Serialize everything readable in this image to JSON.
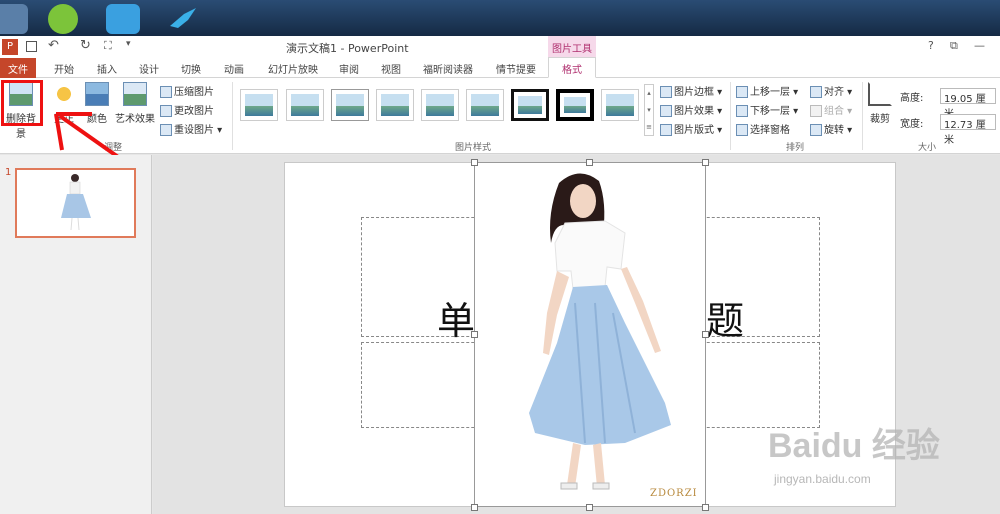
{
  "window": {
    "title": "演示文稿1 - PowerPoint",
    "contextual_group": "图片工具",
    "help": "?",
    "restore": "⧉",
    "minimize": "—"
  },
  "tabs": {
    "file": "文件",
    "items": [
      "开始",
      "插入",
      "设计",
      "切换",
      "动画",
      "幻灯片放映",
      "审阅",
      "视图",
      "福昕阅读器",
      "情节提要"
    ],
    "active": "格式"
  },
  "ribbon": {
    "adjust": {
      "remove_bg": "删除背景",
      "corrections": "更正",
      "color": "颜色",
      "artistic": "艺术效果",
      "compress": "压缩图片",
      "change": "更改图片",
      "reset": "重设图片",
      "group_label": "调整"
    },
    "styles": {
      "group_label": "图片样式",
      "border": "图片边框",
      "effects": "图片效果",
      "layout": "图片版式"
    },
    "arrange": {
      "group_label": "排列",
      "bring_forward": "上移一层",
      "send_backward": "下移一层",
      "selection_pane": "选择窗格",
      "align": "对齐",
      "group": "组合",
      "rotate": "旋转"
    },
    "size": {
      "crop": "裁剪",
      "group_label": "大小",
      "height_label": "高度:",
      "height_value": "19.05 厘米",
      "width_label": "宽度:",
      "width_value": "12.73 厘米"
    }
  },
  "slides": {
    "number": "1"
  },
  "slide": {
    "title_left": "单",
    "title_right": "题",
    "brand": "ZDORZI"
  },
  "watermark": {
    "main": "Baidu 经验",
    "sub": "jingyan.baidu.com"
  },
  "colors": {
    "file_tab": "#c5462a",
    "contextual": "#b0306f",
    "highlight": "#e11111"
  }
}
